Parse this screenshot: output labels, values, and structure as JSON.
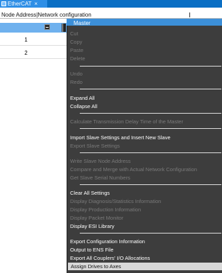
{
  "tab": {
    "label": "EtherCAT",
    "close": "×"
  },
  "header": {
    "column_title": "Node Address|Network configuration"
  },
  "tree": {
    "master_label": "Master",
    "rows": [
      {
        "num": "1"
      },
      {
        "num": "2"
      }
    ]
  },
  "menu": {
    "items": [
      {
        "label": "Cut",
        "enabled": false
      },
      {
        "label": "Copy",
        "enabled": false
      },
      {
        "label": "Paste",
        "enabled": false
      },
      {
        "label": "Delete",
        "enabled": false
      },
      {
        "label": "Undo",
        "enabled": false
      },
      {
        "label": "Redo",
        "enabled": false
      },
      {
        "label": "Expand All",
        "enabled": true
      },
      {
        "label": "Collapse All",
        "enabled": true
      },
      {
        "label": "Calculate Transmission Delay Time of the Master",
        "enabled": false
      },
      {
        "label": "Import Slave Settings and Insert New Slave",
        "enabled": true
      },
      {
        "label": "Export Slave Settings",
        "enabled": false
      },
      {
        "label": "Write Slave Node Address",
        "enabled": false
      },
      {
        "label": "Compare and Merge with Actual Network Configuration",
        "enabled": false
      },
      {
        "label": "Get Slave Serial Numbers",
        "enabled": false
      },
      {
        "label": "Clear All Settings",
        "enabled": true
      },
      {
        "label": "Display Diagnosis/Statistics Information",
        "enabled": false
      },
      {
        "label": "Display Production Information",
        "enabled": false
      },
      {
        "label": "Display Packet Monitor",
        "enabled": false
      },
      {
        "label": "Display ESI Library",
        "enabled": true
      },
      {
        "label": "Export Configuration Information",
        "enabled": true
      },
      {
        "label": "Output to ENS File",
        "enabled": true
      },
      {
        "label": "Export All Couplers' I/O Allocations",
        "enabled": true
      },
      {
        "label": "Assign Drives to Axes",
        "enabled": true,
        "highlighted": true
      }
    ]
  },
  "colors": {
    "tab_bar": "#0b6fc4",
    "selection": "#6fb1ee",
    "menu_bg": "#3d3d3d",
    "menu_highlight": "#d8d8d8",
    "connector": "#f0a030"
  }
}
